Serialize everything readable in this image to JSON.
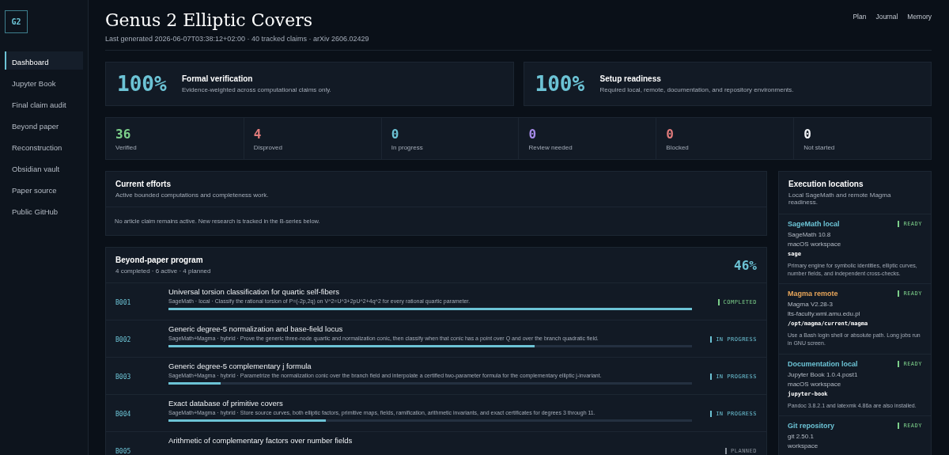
{
  "sidebar": {
    "logo": "G2",
    "items": [
      {
        "label": "Dashboard",
        "selected": true
      },
      {
        "label": "Jupyter Book",
        "selected": false
      },
      {
        "label": "Final claim audit",
        "selected": false
      },
      {
        "label": "Beyond paper",
        "selected": false
      },
      {
        "label": "Reconstruction",
        "selected": false
      },
      {
        "label": "Obsidian vault",
        "selected": false
      },
      {
        "label": "Paper source",
        "selected": false
      },
      {
        "label": "Public GitHub",
        "selected": false
      }
    ]
  },
  "header": {
    "title": "Genus 2 Elliptic Covers",
    "subtitle": "Last generated 2026-06-07T03:38:12+02:00 · 40 tracked claims · arXiv 2606.02429",
    "links": [
      "Plan",
      "Journal",
      "Memory"
    ]
  },
  "summary_cards": [
    {
      "value": "100%",
      "title": "Formal verification",
      "text": "Evidence-weighted across computational claims only."
    },
    {
      "value": "100%",
      "title": "Setup readiness",
      "text": "Required local, remote, documentation, and repository environments."
    }
  ],
  "stats": [
    {
      "value": "36",
      "label": "Verified",
      "color": "#7ccf8a"
    },
    {
      "value": "4",
      "label": "Disproved",
      "color": "#e07b7b"
    },
    {
      "value": "0",
      "label": "In progress",
      "color": "#6cc3d5"
    },
    {
      "value": "0",
      "label": "Review needed",
      "color": "#a68be8"
    },
    {
      "value": "0",
      "label": "Blocked",
      "color": "#e07b7b"
    },
    {
      "value": "0",
      "label": "Not started",
      "color": "#f2f4f7"
    }
  ],
  "current_efforts": {
    "title": "Current efforts",
    "subtitle": "Active bounded computations and completeness work.",
    "note": "No article claim remains active. New research is tracked in the B-series below."
  },
  "program": {
    "title": "Beyond-paper program",
    "subtitle": "4 completed · 6 active · 4 planned",
    "percent": "46%",
    "items": [
      {
        "id": "B001",
        "title": "Universal torsion classification for quartic self-fibers",
        "text": "SageMath · local · Classify the rational torsion of P=(-2p,2q) on V^2=U^3+2pU^2+4q^2 for every rational quartic parameter.",
        "level": 1,
        "status": "COMPLETED",
        "kind": "completed"
      },
      {
        "id": "B002",
        "title": "Generic degree-5 normalization and base-field locus",
        "text": "SageMath+Magma · hybrid · Prove the generic three-node quartic and normalization conic, then classify when that conic has a point over Q and over the branch quadratic field.",
        "level": 0.7,
        "status": "IN PROGRESS",
        "kind": "active"
      },
      {
        "id": "B003",
        "title": "Generic degree-5 complementary j formula",
        "text": "SageMath+Magma · hybrid · Parametrize the normalization conic over the branch field and interpolate a certified two-parameter formula for the complementary elliptic j-invariant.",
        "level": 0.1,
        "status": "IN PROGRESS",
        "kind": "active"
      },
      {
        "id": "B004",
        "title": "Exact database of primitive covers",
        "text": "SageMath+Magma · hybrid · Store source curves, both elliptic factors, primitive maps, fields, ramification, arithmetic invariants, and exact certificates for degrees 3 through 11.",
        "level": 0.3,
        "status": "IN PROGRESS",
        "kind": "active"
      },
      {
        "id": "B005",
        "title": "Arithmetic of complementary factors over number fields",
        "status": "PLANNED",
        "kind": "planned"
      }
    ]
  },
  "locations": {
    "title": "Execution locations",
    "subtitle": "Local SageMath and remote Magma readiness.",
    "items": [
      {
        "name": "SageMath local",
        "color": "#6cc3d5",
        "status": "READY",
        "lines": [
          "SageMath 10.8",
          "macOS workspace"
        ],
        "command": "sage",
        "note": "Primary engine for symbolic identities, elliptic curves, number fields, and independent cross-checks."
      },
      {
        "name": "Magma remote",
        "color": "#e8a65a",
        "status": "READY",
        "lines": [
          "Magma V2.28-3",
          "lts-faculty.wmi.amu.edu.pl"
        ],
        "command": "/opt/magma/current/magma",
        "note": "Use a Bash login shell or absolute path. Long jobs run in GNU screen."
      },
      {
        "name": "Documentation local",
        "color": "#6cc3d5",
        "status": "READY",
        "lines": [
          "Jupyter Book 1.0.4.post1",
          "macOS workspace"
        ],
        "command": "jupyter-book",
        "note": "Pandoc 3.8.2.1 and latexmk 4.86a are also installed."
      },
      {
        "name": "Git repository",
        "color": "#6cc3d5",
        "status": "READY",
        "lines": [
          "git 2.50.1",
          "workspace"
        ]
      }
    ]
  }
}
